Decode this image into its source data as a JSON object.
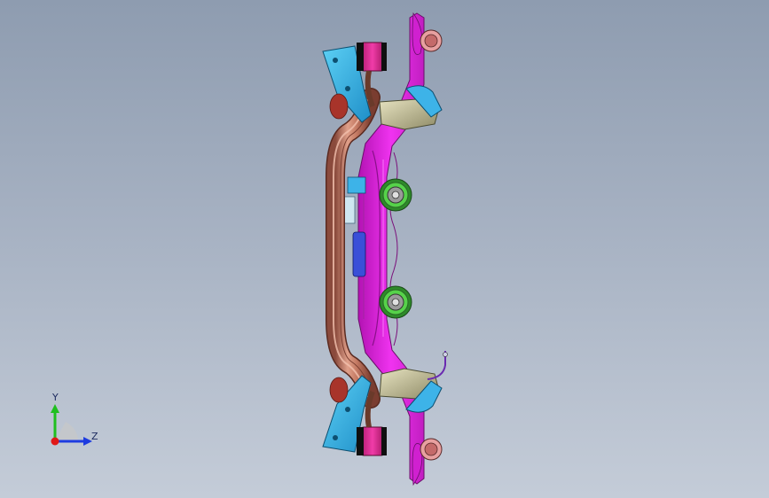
{
  "viewport": {
    "background_top": "#8e9cb0",
    "background_bottom": "#c4ccd8"
  },
  "model": {
    "parts": [
      {
        "name": "main-crossmember",
        "color": "#e629e6"
      },
      {
        "name": "front-rail-tube",
        "color": "#c47a63"
      },
      {
        "name": "mount-brackets",
        "color": "#3db3e8"
      },
      {
        "name": "bushings",
        "color": "#e2298f"
      },
      {
        "name": "engine-mounts",
        "color": "#46c23a"
      },
      {
        "name": "reinforcement-plates",
        "color": "#3a4fd8"
      },
      {
        "name": "bracket-castings",
        "color": "#c9c49a"
      }
    ]
  },
  "triad": {
    "y_label": "Y",
    "z_label": "Z",
    "x_color": "#e01818",
    "y_color": "#1fbf1f",
    "z_color": "#1d3be0"
  }
}
